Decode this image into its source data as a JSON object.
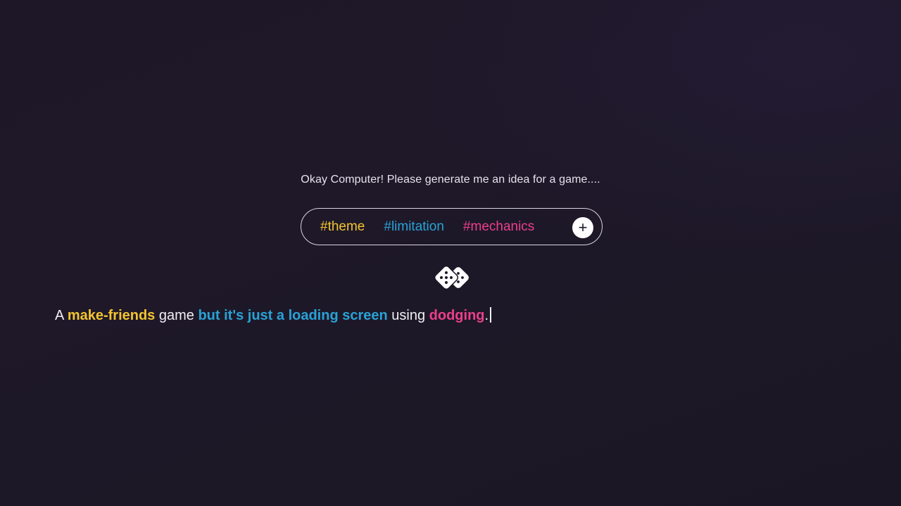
{
  "prompt": {
    "text": "Okay Computer! Please generate me an idea for a game...."
  },
  "tags": {
    "theme": "#theme",
    "limitation": "#limitation",
    "mechanics": "#mechanics",
    "add_label": "+"
  },
  "idea": {
    "prefix": "A",
    "theme_value": "make-friends",
    "middle": "game",
    "limitation_value": "but it's just a loading screen",
    "connector": "using",
    "mechanics_value": "dodging",
    "suffix": "."
  },
  "icons": {
    "dice": "dice-icon"
  },
  "colors": {
    "background": "#1d1727",
    "theme": "#f4c430",
    "limitation": "#29a2d6",
    "mechanics": "#ec3f8c",
    "text": "#f1eff4"
  }
}
